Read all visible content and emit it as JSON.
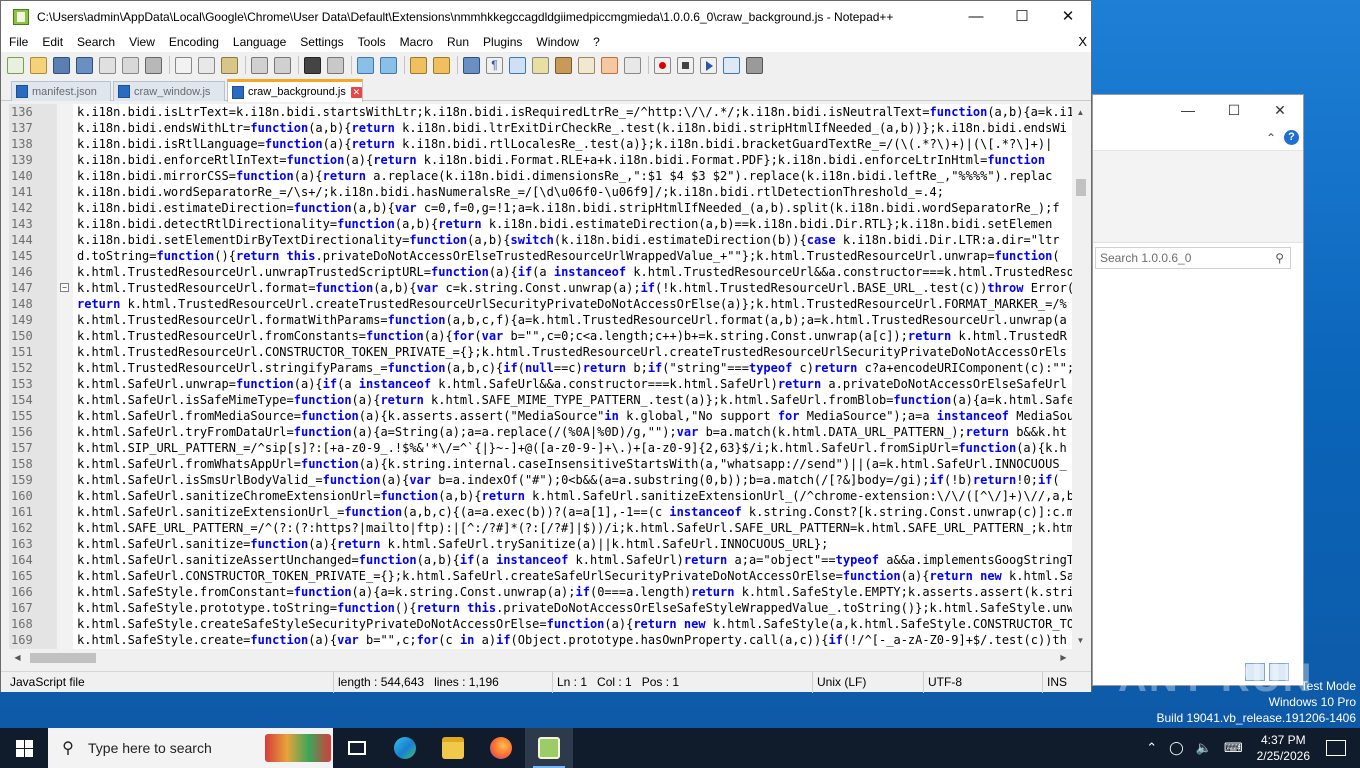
{
  "window": {
    "title": "C:\\Users\\admin\\AppData\\Local\\Google\\Chrome\\User Data\\Default\\Extensions\\nmmhkkegccagdldgiimedpiccmgmieda\\1.0.0.6_0\\craw_background.js - Notepad++",
    "minimize": "—",
    "maximize": "☐",
    "close": "✕"
  },
  "menu": {
    "items": [
      "File",
      "Edit",
      "Search",
      "View",
      "Encoding",
      "Language",
      "Settings",
      "Tools",
      "Macro",
      "Run",
      "Plugins",
      "Window",
      "?"
    ],
    "close_doc": "X"
  },
  "tabs": [
    {
      "label": "manifest.json",
      "active": false
    },
    {
      "label": "craw_window.js",
      "active": false
    },
    {
      "label": "craw_background.js",
      "active": true
    }
  ],
  "editor": {
    "lines": [
      {
        "n": "136",
        "t": "k.i18n.bidi.isLtrText=k.i18n.bidi.startsWithLtr;k.i18n.bidi.isRequiredLtrRe_=/^http:\\/\\/.*/;k.i18n.bidi.isNeutralText=function(a,b){a=k.i18n"
      },
      {
        "n": "137",
        "t": "k.i18n.bidi.endsWithLtr=function(a,b){return k.i18n.bidi.ltrExitDirCheckRe_.test(k.i18n.bidi.stripHtmlIfNeeded_(a,b))};k.i18n.bidi.endsWi"
      },
      {
        "n": "138",
        "t": "k.i18n.bidi.isRtlLanguage=function(a){return k.i18n.bidi.rtlLocalesRe_.test(a)};k.i18n.bidi.bracketGuardTextRe_=/(\\(.*?\\)+)|(\\[.*?\\]+)|"
      },
      {
        "n": "139",
        "t": "k.i18n.bidi.enforceRtlInText=function(a){return k.i18n.bidi.Format.RLE+a+k.i18n.bidi.Format.PDF};k.i18n.bidi.enforceLtrInHtml=function"
      },
      {
        "n": "140",
        "t": "k.i18n.bidi.mirrorCSS=function(a){return a.replace(k.i18n.bidi.dimensionsRe_,\":$1 $4 $3 $2\").replace(k.i18n.bidi.leftRe_,\"%%%%\").replac"
      },
      {
        "n": "141",
        "t": "k.i18n.bidi.wordSeparatorRe_=/\\s+/;k.i18n.bidi.hasNumeralsRe_=/[\\d\\u06f0-\\u06f9]/;k.i18n.bidi.rtlDetectionThreshold_=.4;"
      },
      {
        "n": "142",
        "t": "k.i18n.bidi.estimateDirection=function(a,b){var c=0,f=0,g=!1;a=k.i18n.bidi.stripHtmlIfNeeded_(a,b).split(k.i18n.bidi.wordSeparatorRe_);f"
      },
      {
        "n": "143",
        "t": "k.i18n.bidi.detectRtlDirectionality=function(a,b){return k.i18n.bidi.estimateDirection(a,b)==k.i18n.bidi.Dir.RTL};k.i18n.bidi.setElemen"
      },
      {
        "n": "144",
        "t": "k.i18n.bidi.setElementDirByTextDirectionality=function(a,b){switch(k.i18n.bidi.estimateDirection(b)){case k.i18n.bidi.Dir.LTR:a.dir=\"ltr"
      },
      {
        "n": "145",
        "t": "d.toString=function(){return this.privateDoNotAccessOrElseTrustedResourceUrlWrappedValue_+\"\"};k.html.TrustedResourceUrl.unwrap=function("
      },
      {
        "n": "146",
        "t": "k.html.TrustedResourceUrl.unwrapTrustedScriptURL=function(a){if(a instanceof k.html.TrustedResourceUrl&&a.constructor===k.html.TrustedResou"
      },
      {
        "n": "147",
        "t": "k.html.TrustedResourceUrl.format=function(a,b){var c=k.string.Const.unwrap(a);if(!k.html.TrustedResourceUrl.BASE_URL_.test(c))throw Error(",
        "fold": true
      },
      {
        "n": "148",
        "t": "return k.html.TrustedResourceUrl.createTrustedResourceUrlSecurityPrivateDoNotAccessOrElse(a)};k.html.TrustedResourceUrl.FORMAT_MARKER_=/%",
        "indent": 0
      },
      {
        "n": "149",
        "t": "k.html.TrustedResourceUrl.formatWithParams=function(a,b,c,f){a=k.html.TrustedResourceUrl.format(a,b);a=k.html.TrustedResourceUrl.unwrap(a"
      },
      {
        "n": "150",
        "t": "k.html.TrustedResourceUrl.fromConstants=function(a){for(var b=\"\",c=0;c<a.length;c++)b+=k.string.Const.unwrap(a[c]);return k.html.TrustedR"
      },
      {
        "n": "151",
        "t": "k.html.TrustedResourceUrl.CONSTRUCTOR_TOKEN_PRIVATE_={};k.html.TrustedResourceUrl.createTrustedResourceUrlSecurityPrivateDoNotAccessOrEls"
      },
      {
        "n": "152",
        "t": "k.html.TrustedResourceUrl.stringifyParams_=function(a,b,c){if(null==c)return b;if(\"string\"===typeof c)return c?a+encodeURIComponent(c):\"\";"
      },
      {
        "n": "153",
        "t": "k.html.SafeUrl.unwrap=function(a){if(a instanceof k.html.SafeUrl&&a.constructor===k.html.SafeUrl)return a.privateDoNotAccessOrElseSafeUrl"
      },
      {
        "n": "154",
        "t": "k.html.SafeUrl.isSafeMimeType=function(a){return k.html.SAFE_MIME_TYPE_PATTERN_.test(a)};k.html.SafeUrl.fromBlob=function(a){a=k.html.Safe"
      },
      {
        "n": "155",
        "t": "k.html.SafeUrl.fromMediaSource=function(a){k.asserts.assert(\"MediaSource\"in k.global,\"No support for MediaSource\");a=a instanceof MediaSourc"
      },
      {
        "n": "156",
        "t": "k.html.SafeUrl.tryFromDataUrl=function(a){a=String(a);a=a.replace(/(%0A|%0D)/g,\"\");var b=a.match(k.html.DATA_URL_PATTERN_);return b&&k.ht"
      },
      {
        "n": "157",
        "t": "k.html.SIP_URL_PATTERN_=/^sip[s]?:[+a-z0-9_.!$%&'*\\/=^`{|}~-]+@([a-z0-9-]+\\.)+[a-z0-9]{2,63}$/i;k.html.SafeUrl.fromSipUrl=function(a){k.h"
      },
      {
        "n": "158",
        "t": "k.html.SafeUrl.fromWhatsAppUrl=function(a){k.string.internal.caseInsensitiveStartsWith(a,\"whatsapp://send\")||(a=k.html.SafeUrl.INNOCUOUS_"
      },
      {
        "n": "159",
        "t": "k.html.SafeUrl.isSmsUrlBodyValid_=function(a){var b=a.indexOf(\"#\");0<b&&(a=a.substring(0,b));b=a.match(/[?&]body=/gi);if(!b)return!0;if("
      },
      {
        "n": "160",
        "t": "k.html.SafeUrl.sanitizeChromeExtensionUrl=function(a,b){return k.html.SafeUrl.sanitizeExtensionUrl_(/^chrome-extension:\\/\\/([^\\/]+)\\//,a,b"
      },
      {
        "n": "161",
        "t": "k.html.SafeUrl.sanitizeExtensionUrl_=function(a,b,c){(a=a.exec(b))?(a=a[1],-1==(c instanceof k.string.Const?[k.string.Const.unwrap(c)]:c.m"
      },
      {
        "n": "162",
        "t": "k.html.SAFE_URL_PATTERN_=/^(?:(?:https?|mailto|ftp):|[^:/?#]*(?:[/?#]|$))/i;k.html.SafeUrl.SAFE_URL_PATTERN=k.html.SAFE_URL_PATTERN_;k.htm"
      },
      {
        "n": "163",
        "t": "k.html.SafeUrl.sanitize=function(a){return k.html.SafeUrl.trySanitize(a)||k.html.SafeUrl.INNOCUOUS_URL};"
      },
      {
        "n": "164",
        "t": "k.html.SafeUrl.sanitizeAssertUnchanged=function(a,b){if(a instanceof k.html.SafeUrl)return a;a=\"object\"==typeof a&&a.implementsGoogStringTy"
      },
      {
        "n": "165",
        "t": "k.html.SafeUrl.CONSTRUCTOR_TOKEN_PRIVATE_={};k.html.SafeUrl.createSafeUrlSecurityPrivateDoNotAccessOrElse=function(a){return new k.html.Sa"
      },
      {
        "n": "166",
        "t": "k.html.SafeStyle.fromConstant=function(a){a=k.string.Const.unwrap(a);if(0===a.length)return k.html.SafeStyle.EMPTY;k.asserts.assert(k.stri"
      },
      {
        "n": "167",
        "t": "k.html.SafeStyle.prototype.toString=function(){return this.privateDoNotAccessOrElseSafeStyleWrappedValue_.toString()};k.html.SafeStyle.unwr"
      },
      {
        "n": "168",
        "t": "k.html.SafeStyle.createSafeStyleSecurityPrivateDoNotAccessOrElse=function(a){return new k.html.SafeStyle(a,k.html.SafeStyle.CONSTRUCTOR_TO"
      },
      {
        "n": "169",
        "t": "k.html.SafeStyle.create=function(a){var b=\"\",c;for(c in a)if(Object.prototype.hasOwnProperty.call(a,c)){if(!/^[-_a-zA-Z0-9]+$/.test(c))th"
      }
    ]
  },
  "status": {
    "language": "JavaScript file",
    "length": "length : 544,643",
    "lines": "lines : 1,196",
    "ln": "Ln : 1",
    "col": "Col : 1",
    "pos": "Pos : 1",
    "eol": "Unix (LF)",
    "encoding": "UTF-8",
    "mode": "INS"
  },
  "background_window": {
    "search_placeholder": "Search 1.0.0.6_0"
  },
  "watermark": "ANY RUN",
  "windows_info": {
    "line1": "Test Mode",
    "line2": "Windows 10 Pro",
    "line3": "Build 19041.vb_release.191206-1406"
  },
  "taskbar": {
    "search_placeholder": "Type here to search",
    "time": "4:37 PM",
    "date": "2/25/2026"
  },
  "colors": {
    "keyword": "#0000ff",
    "active_tab_accent": "#f5a623",
    "taskbar": "#101c2b"
  }
}
